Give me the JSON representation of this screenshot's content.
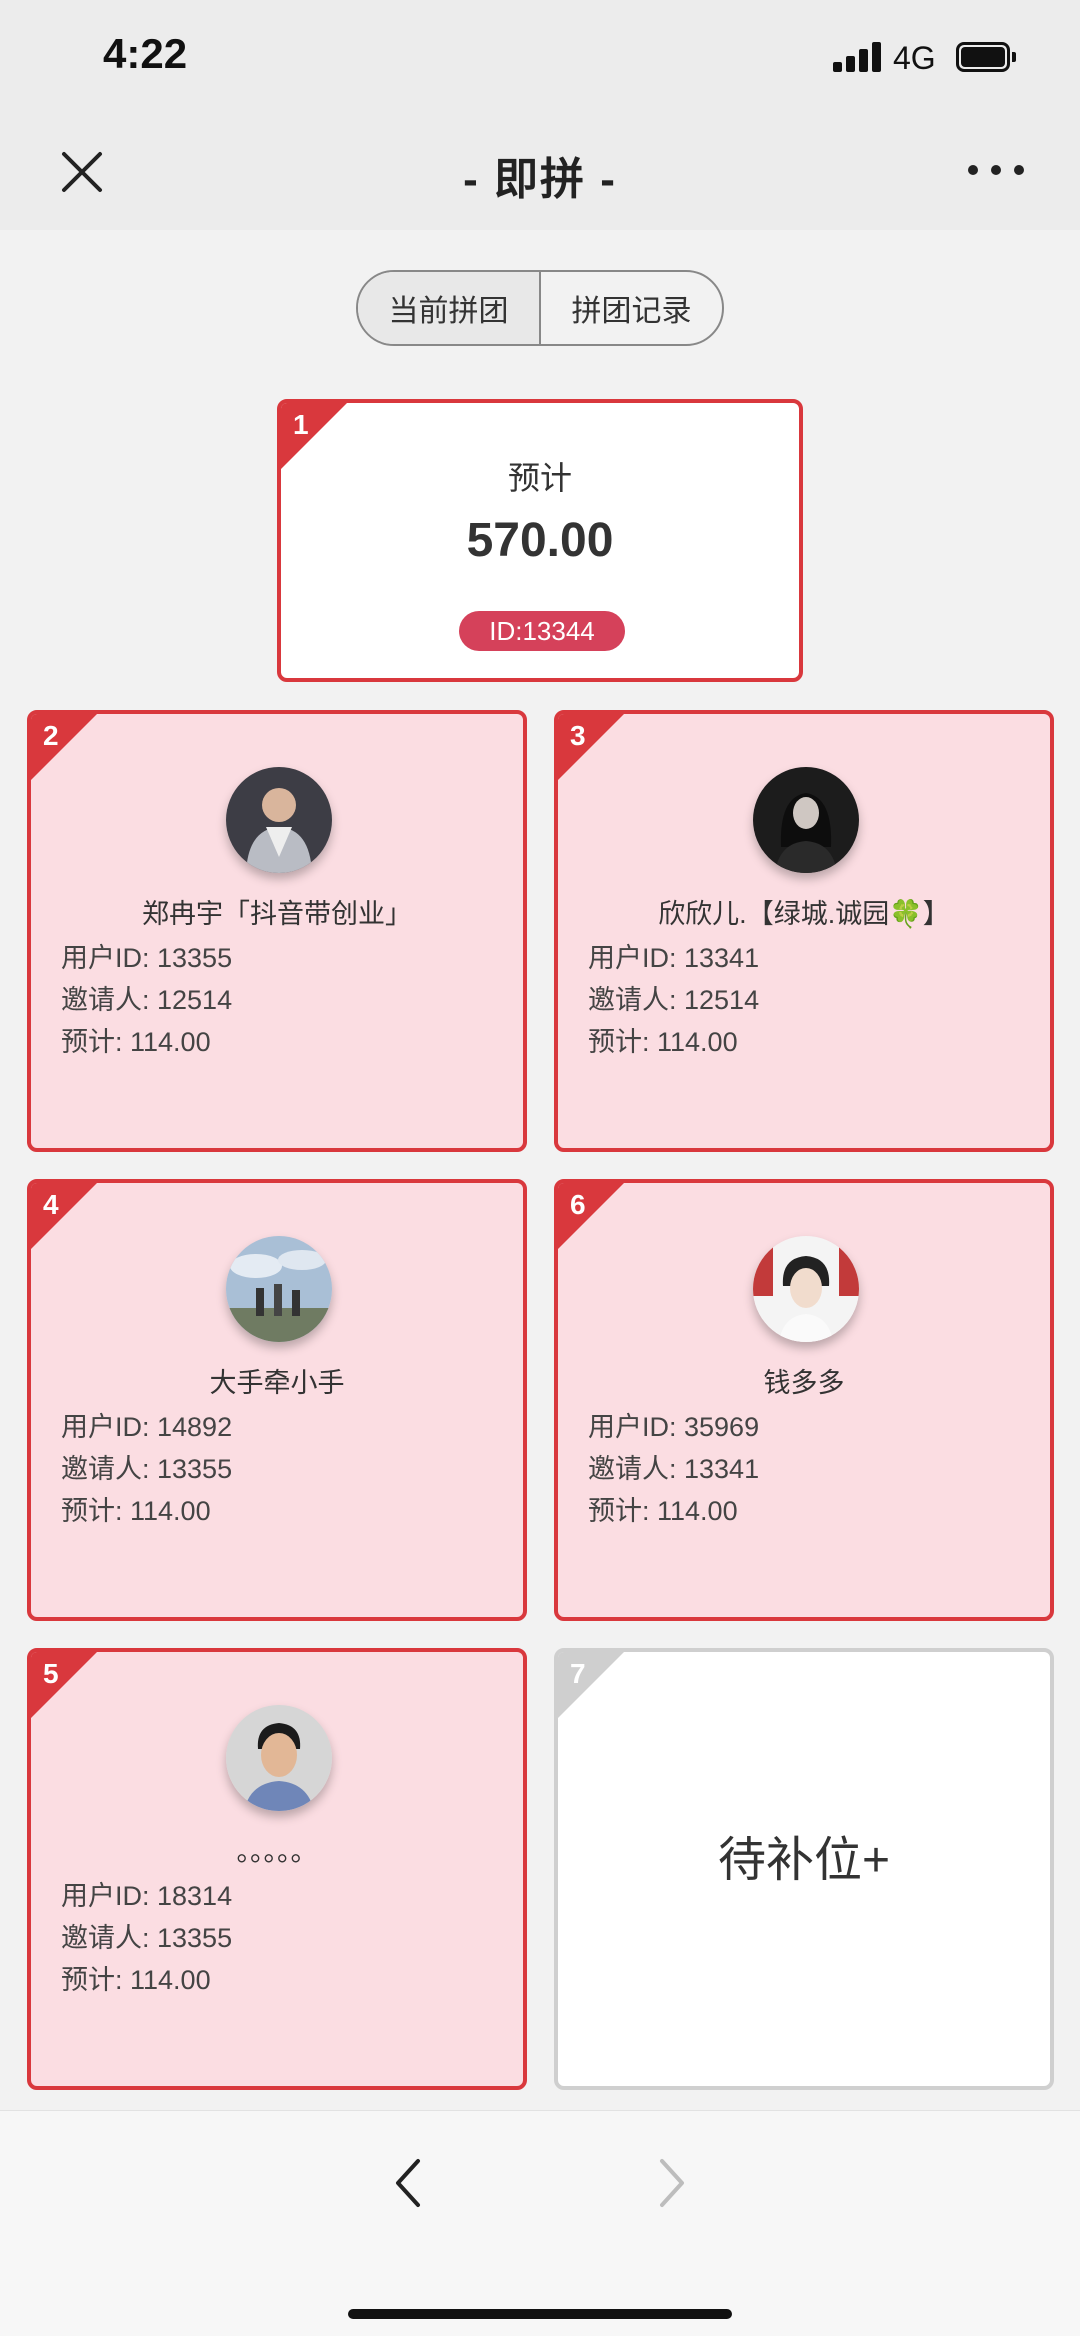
{
  "status_bar": {
    "time": "4:22",
    "network": "4G"
  },
  "nav": {
    "title": "- 即拼 -"
  },
  "tabs": [
    {
      "label": "当前拼团",
      "active": true
    },
    {
      "label": "拼团记录",
      "active": false
    }
  ],
  "leader": {
    "position": "1",
    "label": "预计",
    "amount": "570.00",
    "id_badge": "ID:13344"
  },
  "members": [
    {
      "position": "2",
      "name": "郑冉宇「抖音带创业」",
      "user_id": "用户ID: 13355",
      "inviter": "邀请人: 12514",
      "estimate": "预计: 114.00"
    },
    {
      "position": "3",
      "name": "欣欣儿.【绿城.诚园🍀】",
      "user_id": "用户ID: 13341",
      "inviter": "邀请人: 12514",
      "estimate": "预计: 114.00"
    },
    {
      "position": "4",
      "name": "大手牵小手",
      "user_id": "用户ID: 14892",
      "inviter": "邀请人: 13355",
      "estimate": "预计: 114.00"
    },
    {
      "position": "6",
      "name": "钱多多",
      "user_id": "用户ID: 35969",
      "inviter": "邀请人: 13341",
      "estimate": "预计: 114.00"
    },
    {
      "position": "5",
      "name": "。。。。。",
      "user_id": "用户ID: 18314",
      "inviter": "邀请人: 13355",
      "estimate": "预计: 114.00"
    }
  ],
  "empty_slot": {
    "position": "7",
    "label": "待补位+"
  },
  "colors": {
    "accent": "#d9383d",
    "card_bg": "#fbdde2",
    "badge": "#d5415a",
    "empty_border": "#cfcfcf"
  },
  "icons": {
    "close": "close-icon",
    "more": "more-icon",
    "back": "chevron-left-icon",
    "forward": "chevron-right-icon"
  }
}
